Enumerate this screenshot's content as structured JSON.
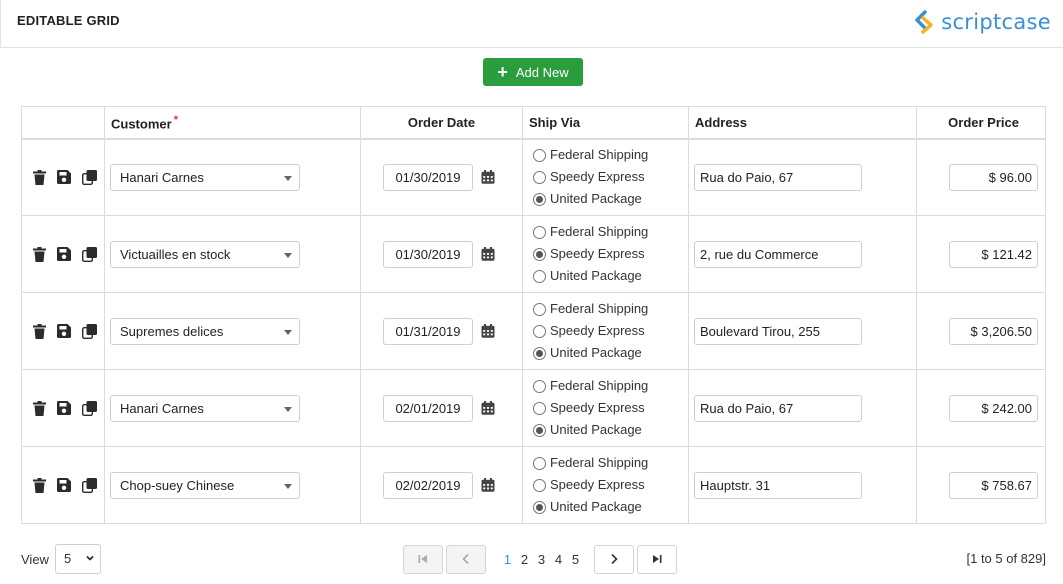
{
  "header": {
    "title": "EDITABLE GRID",
    "logo_text": "scriptcase"
  },
  "toolbar": {
    "add_label": "Add New"
  },
  "columns": {
    "customer": "Customer",
    "customer_required": "*",
    "order_date": "Order Date",
    "ship_via": "Ship Via",
    "address": "Address",
    "order_price": "Order Price"
  },
  "ship_options": [
    "Federal Shipping",
    "Speedy Express",
    "United Package"
  ],
  "rows": [
    {
      "customer": "Hanari Carnes",
      "order_date": "01/30/2019",
      "ship_via": "United Package",
      "address": "Rua do Paio, 67",
      "price": "$ 96.00"
    },
    {
      "customer": "Victuailles en stock",
      "order_date": "01/30/2019",
      "ship_via": "Speedy Express",
      "address": "2, rue du Commerce",
      "price": "$ 121.42"
    },
    {
      "customer": "Supremes delices",
      "order_date": "01/31/2019",
      "ship_via": "United Package",
      "address": "Boulevard Tirou, 255",
      "price": "$ 3,206.50"
    },
    {
      "customer": "Hanari Carnes",
      "order_date": "02/01/2019",
      "ship_via": "United Package",
      "address": "Rua do Paio, 67",
      "price": "$ 242.00"
    },
    {
      "customer": "Chop-suey Chinese",
      "order_date": "02/02/2019",
      "ship_via": "United Package",
      "address": "Hauptstr. 31",
      "price": "$ 758.67"
    }
  ],
  "footer": {
    "view_label": "View",
    "view_value": "5",
    "pages": [
      "1",
      "2",
      "3",
      "4",
      "5"
    ],
    "active_page": "1",
    "count": "[1 to 5 of 829]"
  },
  "colors": {
    "accent": "#2a9d3c",
    "link": "#3b8fd6",
    "logo_arrow_blue": "#3b8fd6",
    "logo_arrow_yellow": "#f2b531"
  },
  "icons": {
    "row_actions": [
      "trash-icon",
      "save-icon",
      "copy-icon"
    ],
    "date": "calendar-icon",
    "pager": [
      "first-page-icon",
      "prev-page-icon",
      "next-page-icon",
      "last-page-icon"
    ]
  }
}
